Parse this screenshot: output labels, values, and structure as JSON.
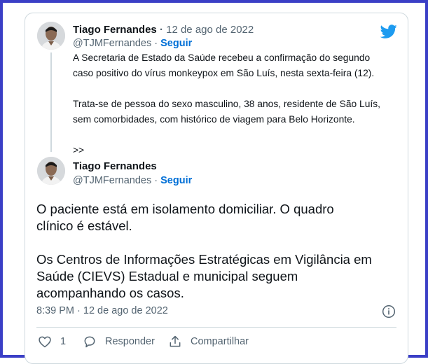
{
  "tweet1": {
    "author": "Tiago Fernandes",
    "separator": "·",
    "date": "12 de ago de 2022",
    "handle": "@TJMFernandes",
    "follow_sep": "·",
    "follow_label": "Seguir",
    "text": "A Secretaria de Estado da Saúde recebeu a confirmação do segundo\ncaso positivo do vírus monkeypox em São Luís, nesta sexta-feira (12).\n\nTrata-se de pessoa do sexo masculino, 38 anos, residente de São Luís,\nsem comorbidades, com histórico de viagem para Belo Horizonte.\n\n>>"
  },
  "tweet2": {
    "author": "Tiago Fernandes",
    "handle": "@TJMFernandes",
    "follow_sep": "·",
    "follow_label": "Seguir",
    "text": "O paciente está em isolamento domiciliar. O quadro\nclínico é estável.\n\nOs Centros de Informações Estratégicas em Vigilância em\nSaúde (CIEVS) Estadual e municipal seguem\nacompanhando os casos.",
    "timestamp": "8:39 PM · 12 de ago de 2022",
    "like_count": "1",
    "reply_label": "Responder",
    "share_label": "Compartilhar"
  },
  "icons": {
    "brand": "twitter-bird-icon",
    "info": "info-icon",
    "like": "heart-icon",
    "reply": "reply-bubble-icon",
    "share": "share-icon"
  },
  "colors": {
    "brand": "#1d9bf0",
    "link": "#006fd6",
    "text": "#0f1419",
    "muted": "#536471",
    "frame": "#3b3fc6",
    "border": "#cfd9de"
  }
}
